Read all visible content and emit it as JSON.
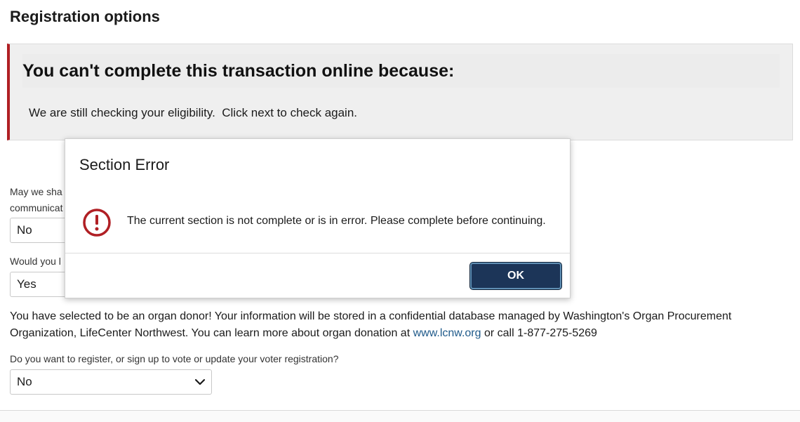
{
  "page": {
    "title": "Registration options"
  },
  "alert": {
    "heading": "You can't complete this transaction online because:",
    "body": "We are still checking your eligibility.  Click next to check again.",
    "accent_color": "#b01f24"
  },
  "questions": [
    {
      "label_line1": "May we sha",
      "label_line2": "communicat",
      "value": "No"
    },
    {
      "label_line1": "Would you l",
      "value": "Yes"
    },
    {
      "label_line1": "Do you want to register, or sign up to vote or update your voter registration?",
      "value": "No",
      "icon": "chevron-down-icon"
    }
  ],
  "donor_info": {
    "text_before_link": "You have selected to be an organ donor! Your information will be stored in a confidential database managed by Washington's Organ Procurement Organization, LifeCenter Northwest. You can learn more about organ donation at ",
    "link_text": "www.lcnw.org",
    "text_after_link": " or call 1-877-275-5269"
  },
  "modal": {
    "title": "Section Error",
    "message": "The current section is not complete or is in error. Please complete before continuing.",
    "icon": "error-icon",
    "ok_label": "OK",
    "icon_color": "#b01f24",
    "button_color": "#1c3558"
  }
}
